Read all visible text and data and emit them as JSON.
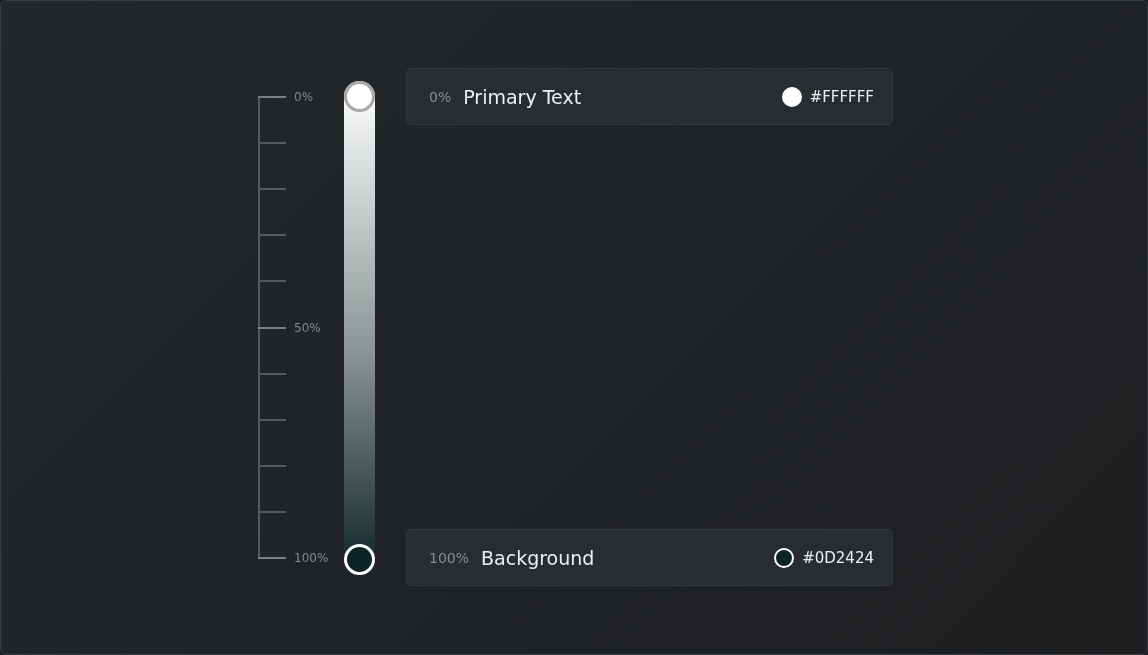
{
  "scale": {
    "labels": [
      "0%",
      "50%",
      "100%"
    ]
  },
  "stops": [
    {
      "percent": "0%",
      "name": "Primary Text",
      "hex": "#FFFFFF",
      "color": "#ffffff"
    },
    {
      "percent": "100%",
      "name": "Background",
      "hex": "#0D2424",
      "color": "#0d2424"
    }
  ]
}
